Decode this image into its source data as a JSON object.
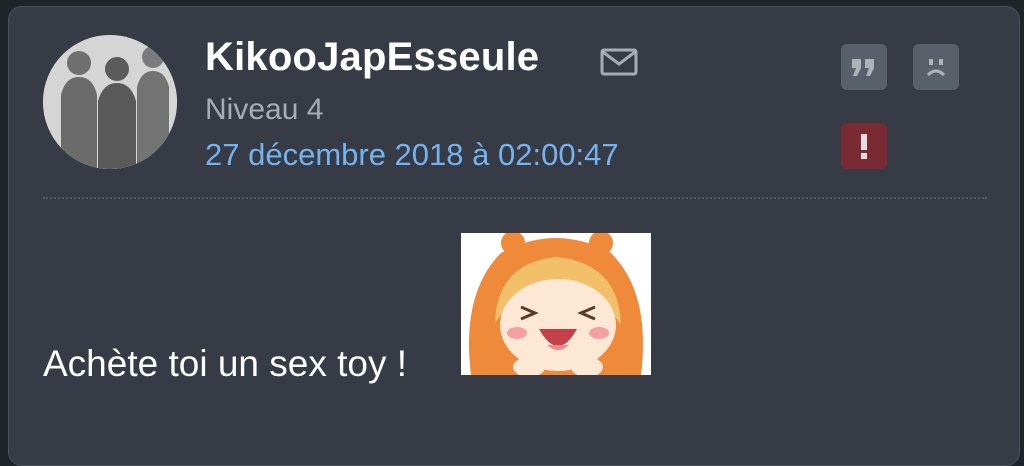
{
  "post": {
    "username": "KikooJapEsseule",
    "level": "Niveau 4",
    "date": "27 décembre 2018 à 02:00:47",
    "message": "Achète toi un sex toy !"
  },
  "icons": {
    "mail": "envelope-icon",
    "quote": "quote-icon",
    "sad": "sad-face-icon",
    "alert": "exclamation-icon"
  },
  "colors": {
    "background": "#363b45",
    "date": "#74b3f0",
    "alert": "#7a2a32"
  }
}
